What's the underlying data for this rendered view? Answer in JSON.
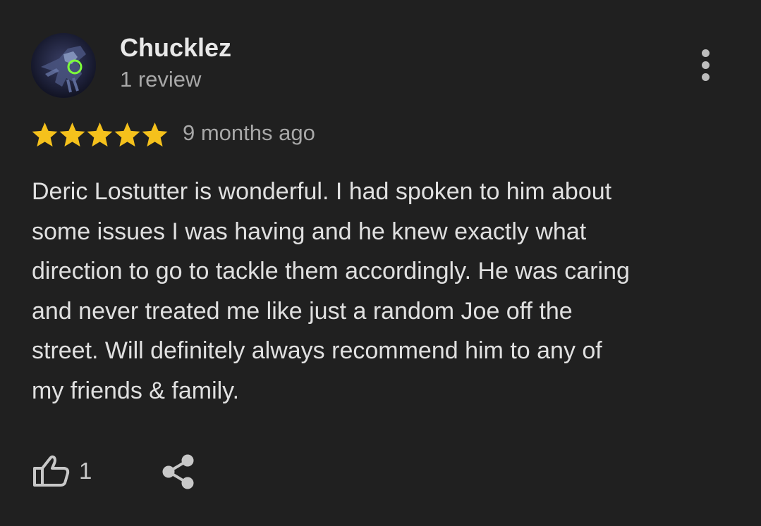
{
  "review": {
    "reviewer": {
      "name": "Chucklez",
      "review_count": "1 review",
      "avatar": "reviewer-avatar-image"
    },
    "rating": 5,
    "max_rating": 5,
    "time_ago": "9 months ago",
    "text_lines": [
      "Deric Lostutter is wonderful. I had spoken to him about",
      "some issues I was having and he knew exactly what",
      "direction to go to tackle them accordingly. He was caring",
      "and never treated me like just a random Joe off the",
      "street. Will definitely always recommend him to any of",
      "my friends & family."
    ],
    "likes": "1",
    "actions": {
      "more": "more-vert-icon",
      "like": "thumb-up-icon",
      "share": "share-icon"
    }
  },
  "colors": {
    "background": "#202020",
    "star": "#f5c11c",
    "text": "#e0e0e0",
    "secondary_text": "#a8a8a8"
  }
}
